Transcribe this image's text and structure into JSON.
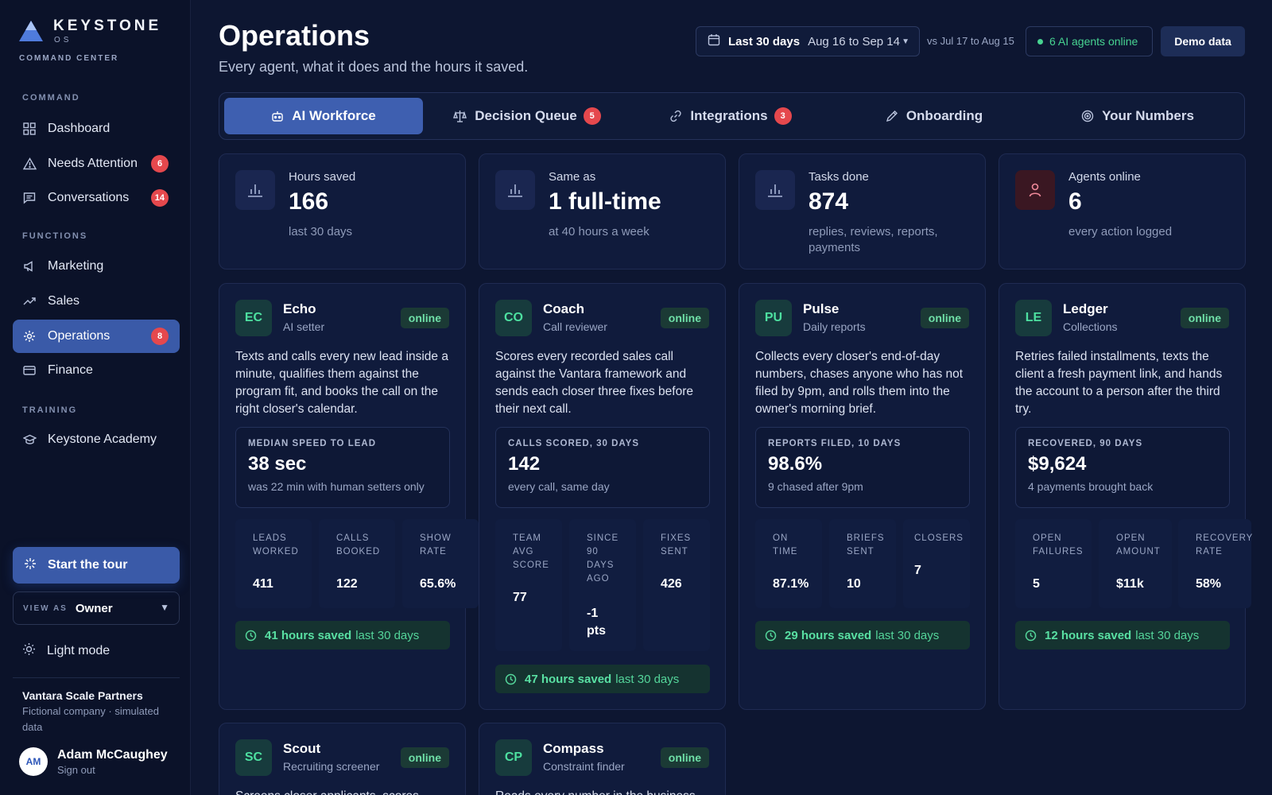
{
  "brand": {
    "name": "KEYSTONE",
    "os": "OS",
    "subtitle": "COMMAND CENTER"
  },
  "sidebar": {
    "sections": [
      {
        "label": "COMMAND"
      },
      {
        "label": "FUNCTIONS"
      },
      {
        "label": "TRAINING"
      }
    ],
    "items": [
      {
        "label": "Dashboard",
        "icon": "grid-icon"
      },
      {
        "label": "Needs Attention",
        "icon": "warning-icon",
        "badge": "6"
      },
      {
        "label": "Conversations",
        "icon": "chat-icon",
        "badge": "14"
      },
      {
        "label": "Marketing",
        "icon": "megaphone-icon"
      },
      {
        "label": "Sales",
        "icon": "trend-up-icon"
      },
      {
        "label": "Operations",
        "icon": "gear-icon",
        "badge": "8",
        "active": true
      },
      {
        "label": "Finance",
        "icon": "card-icon"
      },
      {
        "label": "Keystone Academy",
        "icon": "graduation-cap-icon"
      }
    ],
    "tour_label": "Start the tour",
    "view_as": {
      "label": "VIEW AS",
      "value": "Owner"
    },
    "light_mode_label": "Light mode",
    "company": {
      "name": "Vantara Scale Partners",
      "desc": "Fictional company · simulated data"
    },
    "user": {
      "initials": "AM",
      "name": "Adam McCaughey",
      "signout": "Sign out"
    }
  },
  "header": {
    "title": "Operations",
    "subtitle": "Every agent, what it does and the hours it saved.",
    "range_label": "Last 30 days",
    "range_value": "Aug 16 to Sep 14",
    "compare": "vs Jul 17 to Aug 15",
    "agents_online": "6 AI agents online",
    "demo_label": "Demo data"
  },
  "tabs": [
    {
      "label": "AI Workforce",
      "icon": "robot-icon",
      "active": true
    },
    {
      "label": "Decision Queue",
      "icon": "scales-icon",
      "badge": "5"
    },
    {
      "label": "Integrations",
      "icon": "link-icon",
      "badge": "3"
    },
    {
      "label": "Onboarding",
      "icon": "pencil-icon"
    },
    {
      "label": "Your Numbers",
      "icon": "target-icon"
    }
  ],
  "stats": [
    {
      "label": "Hours saved",
      "value": "166",
      "desc": "last 30 days",
      "icon": "bar-chart-icon"
    },
    {
      "label": "Same as",
      "value": "1 full-time",
      "desc": "at 40 hours a week",
      "icon": "bar-chart-icon"
    },
    {
      "label": "Tasks done",
      "value": "874",
      "desc": "replies, reviews, reports, payments",
      "icon": "bar-chart-icon"
    },
    {
      "label": "Agents online",
      "value": "6",
      "desc": "every action logged",
      "icon": "person-icon"
    }
  ],
  "agents": [
    {
      "abbr": "EC",
      "name": "Echo",
      "role": "AI setter",
      "status": "online",
      "desc": "Texts and calls every new lead inside a minute, qualifies them against the program fit, and books the call on the right closer's calendar.",
      "metric": {
        "label": "MEDIAN SPEED TO LEAD",
        "value": "38 sec",
        "desc": "was 22 min with human setters only"
      },
      "subs": [
        {
          "label": "LEADS WORKED",
          "value": "411"
        },
        {
          "label": "CALLS BOOKED",
          "value": "122"
        },
        {
          "label": "SHOW RATE",
          "value": "65.6%"
        }
      ],
      "saved_bold": "41 hours saved",
      "saved_rest": "last 30 days"
    },
    {
      "abbr": "CO",
      "name": "Coach",
      "role": "Call reviewer",
      "status": "online",
      "desc": "Scores every recorded sales call against the Vantara framework and sends each closer three fixes before their next call.",
      "metric": {
        "label": "CALLS SCORED, 30 DAYS",
        "value": "142",
        "desc": "every call, same day"
      },
      "subs": [
        {
          "label": "TEAM AVG SCORE",
          "value": "77"
        },
        {
          "label": "SINCE 90 DAYS AGO",
          "value": "-1 pts"
        },
        {
          "label": "FIXES SENT",
          "value": "426"
        }
      ],
      "saved_bold": "47 hours saved",
      "saved_rest": "last 30 days"
    },
    {
      "abbr": "PU",
      "name": "Pulse",
      "role": "Daily reports",
      "status": "online",
      "desc": "Collects every closer's end-of-day numbers, chases anyone who has not filed by 9pm, and rolls them into the owner's morning brief.",
      "metric": {
        "label": "REPORTS FILED, 10 DAYS",
        "value": "98.6%",
        "desc": "9 chased after 9pm"
      },
      "subs": [
        {
          "label": "ON TIME",
          "value": "87.1%"
        },
        {
          "label": "BRIEFS SENT",
          "value": "10"
        },
        {
          "label": "CLOSERS",
          "value": "7"
        }
      ],
      "saved_bold": "29 hours saved",
      "saved_rest": "last 30 days"
    },
    {
      "abbr": "LE",
      "name": "Ledger",
      "role": "Collections",
      "status": "online",
      "desc": "Retries failed installments, texts the client a fresh payment link, and hands the account to a person after the third try.",
      "metric": {
        "label": "RECOVERED, 90 DAYS",
        "value": "$9,624",
        "desc": "4 payments brought back"
      },
      "subs": [
        {
          "label": "OPEN FAILURES",
          "value": "5"
        },
        {
          "label": "OPEN AMOUNT",
          "value": "$11k"
        },
        {
          "label": "RECOVERY RATE",
          "value": "58%"
        }
      ],
      "saved_bold": "12 hours saved",
      "saved_rest": "last 30 days"
    },
    {
      "abbr": "SC",
      "name": "Scout",
      "role": "Recruiting screener",
      "status": "online",
      "desc": "Screens closer applicants, scores"
    },
    {
      "abbr": "CP",
      "name": "Compass",
      "role": "Constraint finder",
      "status": "online",
      "desc": "Reads every number in the business"
    }
  ]
}
